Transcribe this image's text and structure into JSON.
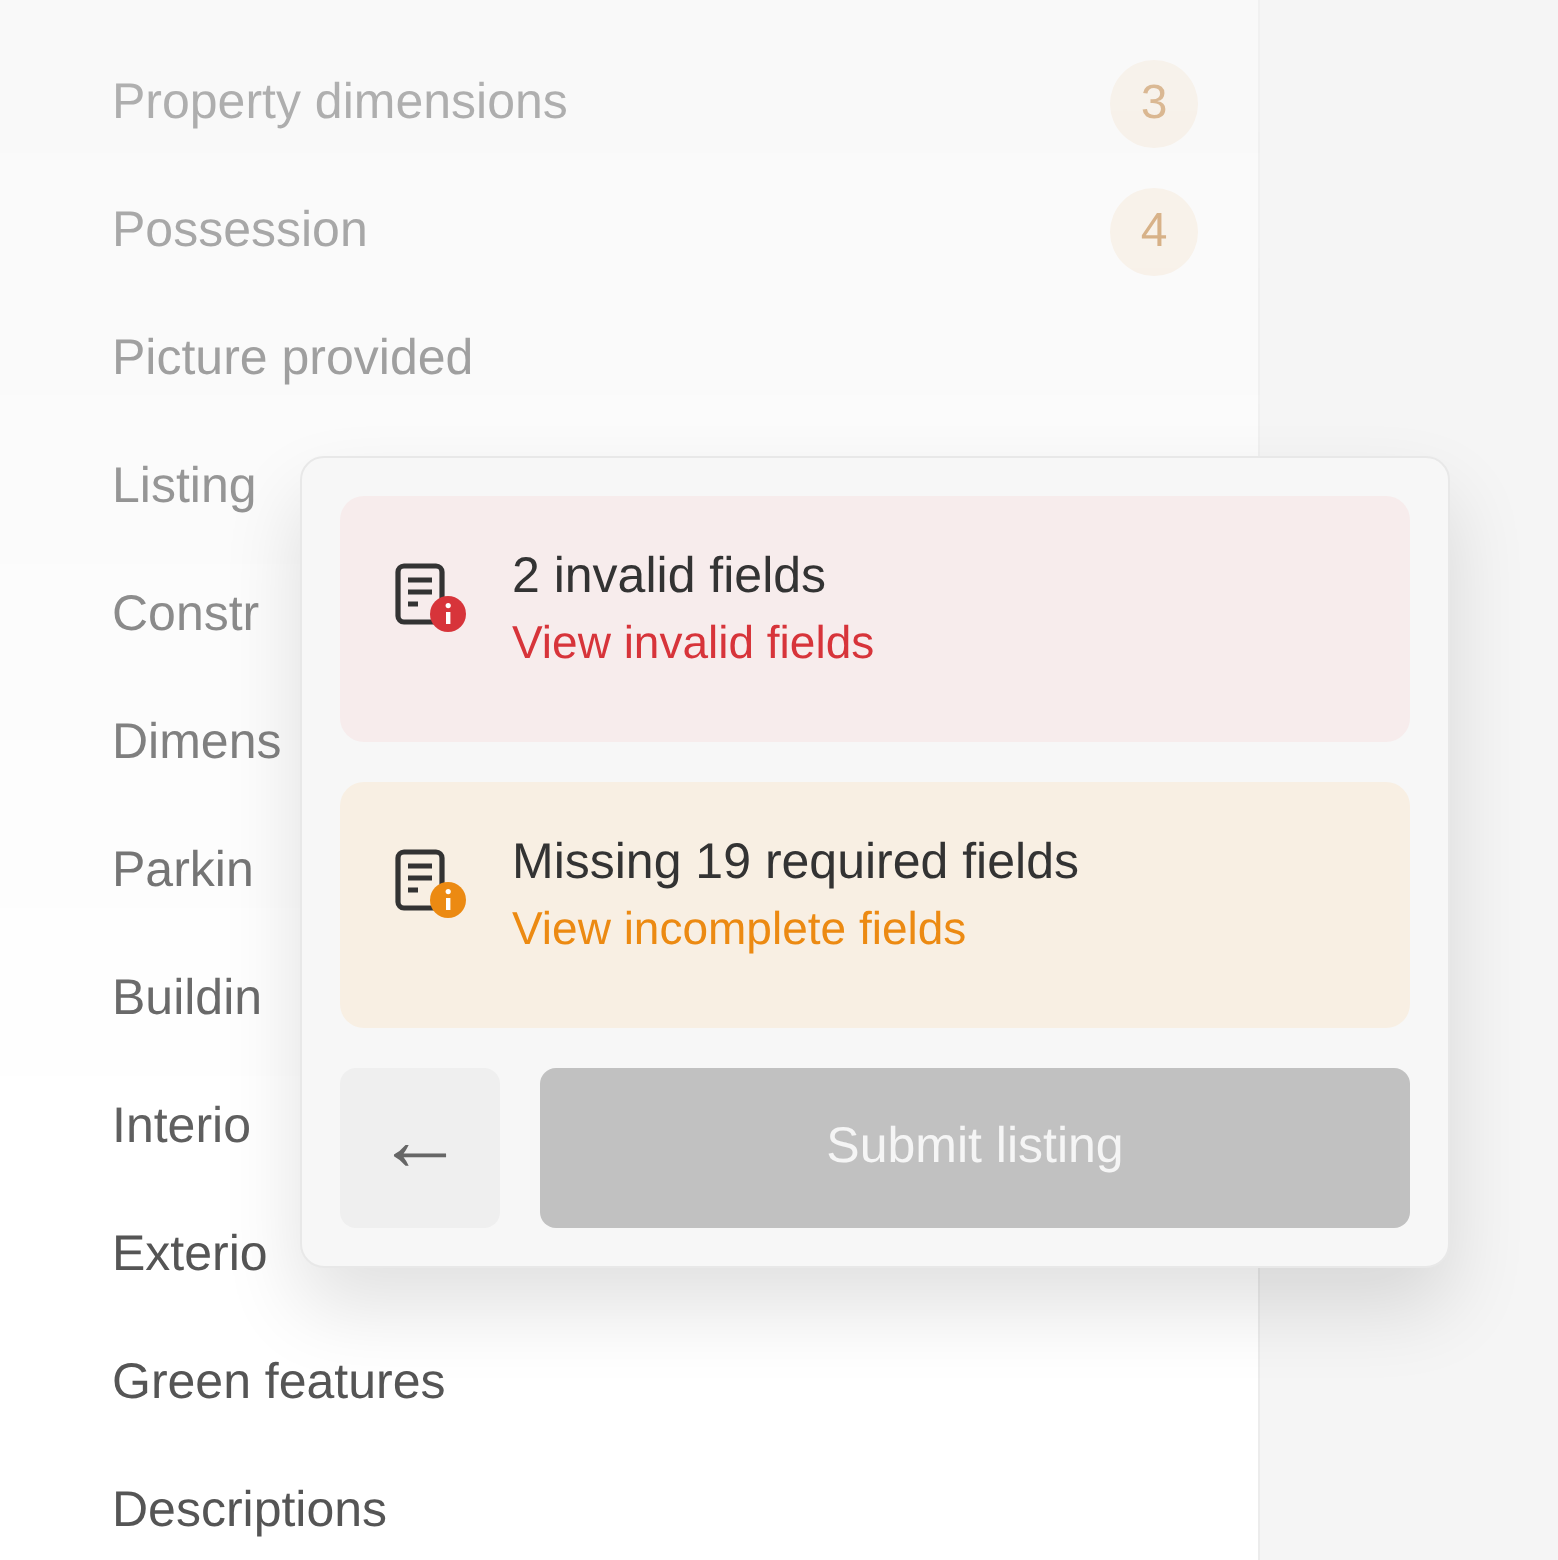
{
  "sidebar": {
    "items": [
      {
        "label": "Property dimensions",
        "badge": "3"
      },
      {
        "label": "Possession",
        "badge": "4"
      },
      {
        "label": "Picture provided"
      },
      {
        "label": "Listing"
      },
      {
        "label": "Constr"
      },
      {
        "label": "Dimens"
      },
      {
        "label": "Parkin"
      },
      {
        "label": "Buildin"
      },
      {
        "label": "Interio"
      },
      {
        "label": "Exterio"
      },
      {
        "label": "Green features"
      },
      {
        "label": "Descriptions"
      }
    ]
  },
  "popup": {
    "alerts": [
      {
        "kind": "error",
        "title": "2 invalid fields",
        "link": "View invalid fields"
      },
      {
        "kind": "warning",
        "title": "Missing 19 required fields",
        "link": "View incomplete fields"
      }
    ],
    "back_button": "←",
    "submit_button": {
      "label": "Submit listing",
      "disabled": true
    }
  }
}
